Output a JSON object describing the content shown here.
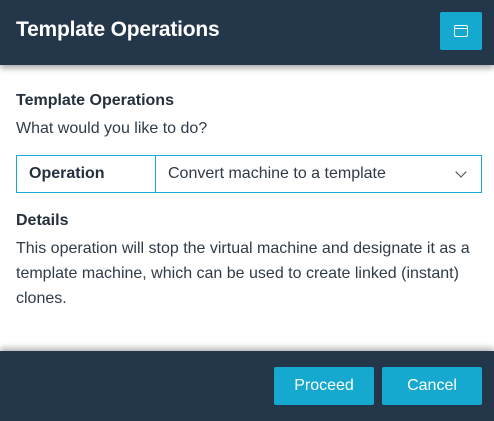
{
  "header": {
    "title": "Template Operations",
    "maximize_icon": "window-maximize-icon"
  },
  "content": {
    "section_title": "Template Operations",
    "prompt": "What would you like to do?",
    "operation": {
      "label": "Operation",
      "selected": "Convert machine to a template"
    },
    "details_title": "Details",
    "details_text": "This operation will stop the virtual machine and designate it as a template machine, which can be used to create linked (instant) clones."
  },
  "footer": {
    "proceed_label": "Proceed",
    "cancel_label": "Cancel"
  },
  "colors": {
    "header_bg": "#24364a",
    "accent": "#16a9cf",
    "text": "#2f3b47"
  }
}
